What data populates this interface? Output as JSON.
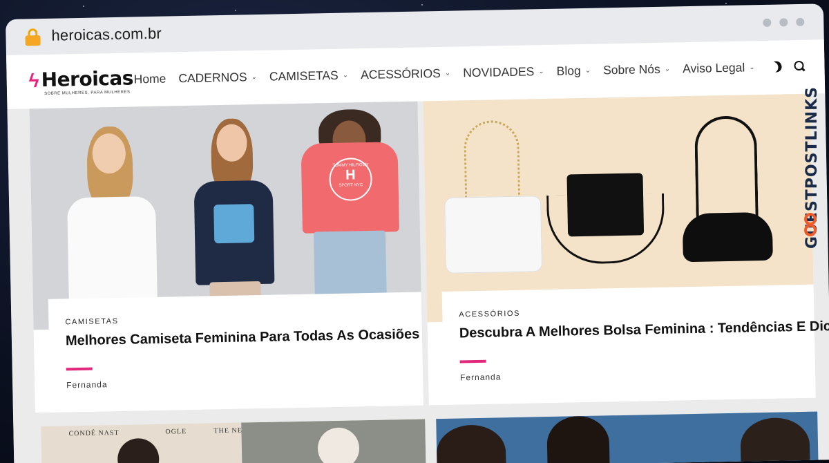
{
  "browser": {
    "url": "heroicas.com.br"
  },
  "site": {
    "logo_text": "Heroicas",
    "logo_tagline": "SOBRE MULHERES, PARA MULHERES"
  },
  "nav": {
    "items": [
      {
        "label": "Home",
        "dropdown": false
      },
      {
        "label": "CADERNOS",
        "dropdown": true
      },
      {
        "label": "CAMISETAS",
        "dropdown": true
      },
      {
        "label": "ACESSÓRIOS",
        "dropdown": true
      },
      {
        "label": "NOVIDADES",
        "dropdown": true
      },
      {
        "label": "Blog",
        "dropdown": true
      },
      {
        "label": "Sobre Nós",
        "dropdown": true
      },
      {
        "label": "Aviso Legal",
        "dropdown": true
      }
    ],
    "chevron": "⌄",
    "icons": [
      "moon-icon",
      "search-icon"
    ]
  },
  "posts": [
    {
      "category": "CAMISETAS",
      "title": "Melhores Camiseta Feminina Para Todas As Ocasiões",
      "author": "Fernanda",
      "image_text": [
        "TOMMY HILFIGER",
        "SPORT NYC"
      ]
    },
    {
      "category": "ACESSÓRIOS",
      "title": "Descubra A Melhores Bolsa Feminina : Tendências E Dicas",
      "author": "Fernanda"
    }
  ],
  "lower_cards": {
    "left_magazine_text": [
      "CONDÉ NAST",
      "OGLE",
      "THE NEW YO"
    ]
  },
  "watermark": {
    "text": "GUESTPOSTLINKS"
  },
  "colors": {
    "accent": "#e0287c",
    "lock": "#f5a623",
    "watermark_icon": "#ef5a2a"
  }
}
